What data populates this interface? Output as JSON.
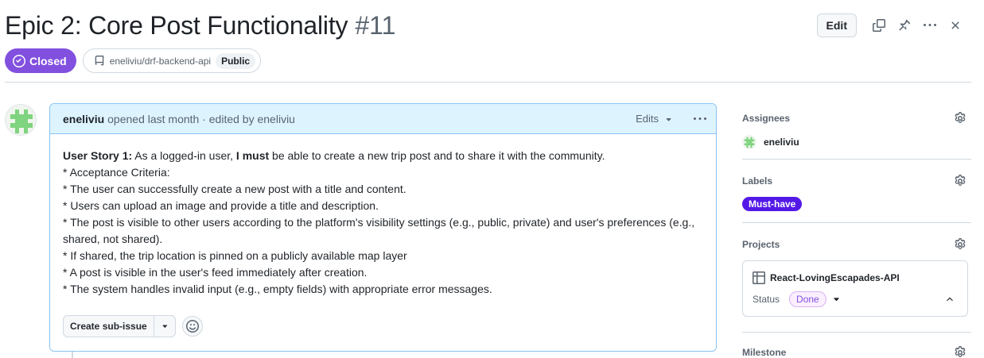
{
  "issue": {
    "title": "Epic 2: Core Post Functionality",
    "number": "#11",
    "state": "Closed",
    "repo": "eneliviu/drf-backend-api",
    "visibility": "Public"
  },
  "header_actions": {
    "edit_label": "Edit"
  },
  "comment": {
    "author": "eneliviu",
    "meta": "opened last month · edited by eneliviu",
    "edits_label": "Edits",
    "story_label": "User Story 1:",
    "story_part1": " As a logged-in user, ",
    "story_must": "I must",
    "story_part2": " be able to create a new trip post and to share it with the community.",
    "lines": [
      "* Acceptance Criteria:",
      "* The user can successfully create a new post with a title and content.",
      "* Users can upload an image and provide a title and description.",
      "* The post is visible to other users according to the platform's visibility settings (e.g., public, private) and user's preferences (e.g., shared, not shared).",
      "* If shared, the trip location is pinned on a publicly available map layer",
      "* A post is visible in the user's feed immediately after creation.",
      "* The system handles invalid input (e.g., empty fields) with appropriate error messages."
    ],
    "create_subissue_label": "Create sub-issue"
  },
  "sidebar": {
    "assignees_title": "Assignees",
    "assignee": "eneliviu",
    "labels_title": "Labels",
    "label": "Must-have",
    "label_color": "#5319e7",
    "projects_title": "Projects",
    "project_name": "React-LovingEscapades-API",
    "status_label": "Status",
    "status_value": "Done",
    "milestone_title": "Milestone"
  },
  "colors": {
    "closed_badge": "#8250df",
    "comment_header_bg": "#ddf4ff",
    "comment_border": "#88c3f3"
  }
}
